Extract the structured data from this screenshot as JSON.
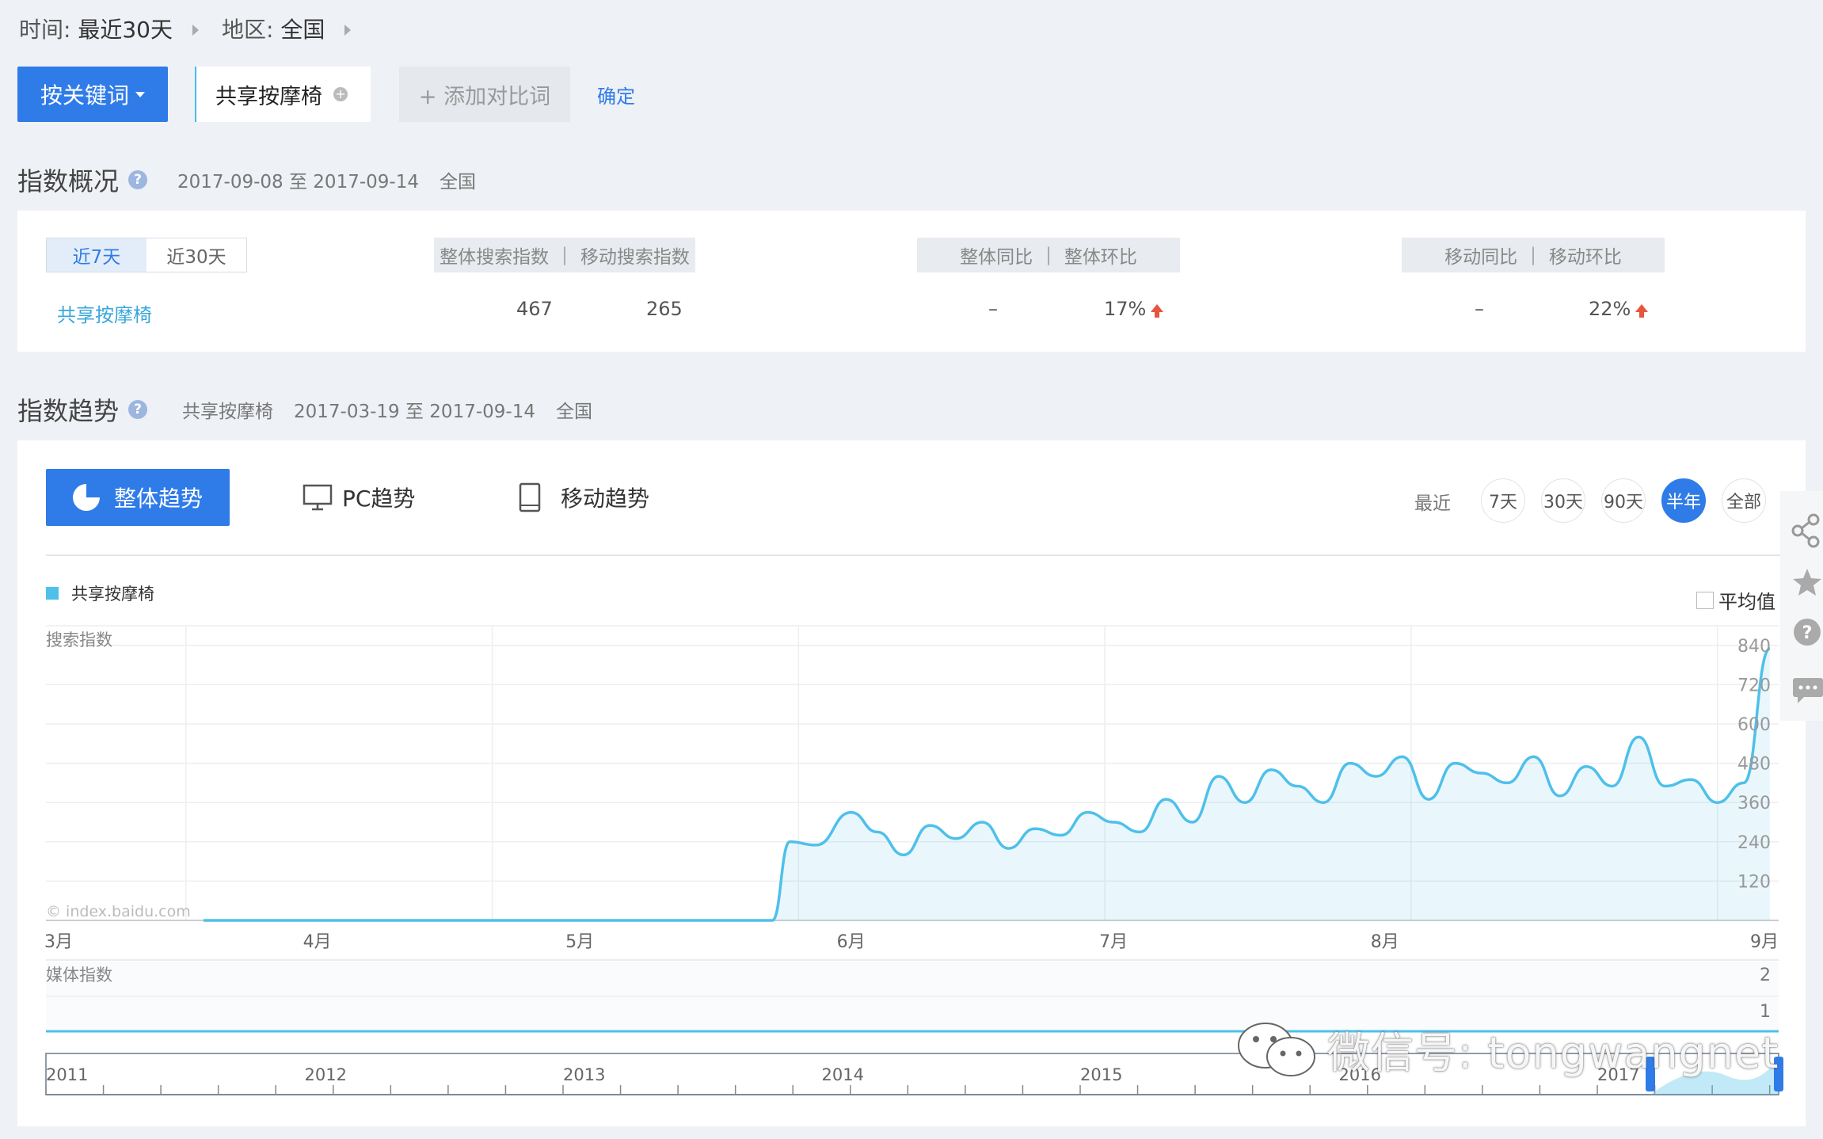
{
  "filters": {
    "time_label": "时间:",
    "time_value": "最近30天",
    "region_label": "地区:",
    "region_value": "全国"
  },
  "toolbar": {
    "mode_button": "按关键词",
    "keyword": "共享按摩椅",
    "add_compare": "+ 添加对比词",
    "confirm": "确定"
  },
  "overview": {
    "title": "指数概况",
    "help": "?",
    "date_range": "2017-09-08 至 2017-09-14",
    "region": "全国",
    "tabs": [
      "近7天",
      "近30天"
    ],
    "col_search": "整体搜索指数",
    "col_mobile": "移动搜索指数",
    "col_yoy": "整体同比",
    "col_mom": "整体环比",
    "col_mobile_yoy": "移动同比",
    "col_mobile_mom": "移动环比",
    "row": {
      "keyword": "共享按摩椅",
      "search_index": "467",
      "mobile_index": "265",
      "yoy": "–",
      "mom": "17%",
      "mobile_yoy": "–",
      "mobile_mom": "22%"
    }
  },
  "trend": {
    "title": "指数趋势",
    "help": "?",
    "keyword": "共享按摩椅",
    "date_range": "2017-03-19 至 2017-09-14",
    "region": "全国",
    "tabs": {
      "overall": "整体趋势",
      "pc": "PC趋势",
      "mobile": "移动趋势"
    },
    "recent_label": "最近",
    "ranges": [
      "7天",
      "30天",
      "90天",
      "半年",
      "全部"
    ],
    "active_range": 3,
    "avg_label": "平均值",
    "copyright": "© index.baidu.com",
    "media_label": "媒体指数",
    "media_ticks": [
      "2",
      "1"
    ],
    "timeline_years": [
      "2011",
      "2012",
      "2013",
      "2014",
      "2015",
      "2016",
      "2017"
    ]
  },
  "colors": {
    "accent": "#2f7ce8",
    "series": "#4ec0ea",
    "up": "#e8553e"
  },
  "icons": [
    "pie-chart-icon",
    "monitor-icon",
    "tablet-icon",
    "share-icon",
    "star-icon",
    "help-icon",
    "chat-icon",
    "wechat-icon"
  ],
  "watermark": "微信号: tongwangnet",
  "chart_data": {
    "type": "area",
    "title": "",
    "ylabel": "搜索指数",
    "ylim": [
      0,
      900
    ],
    "yticks": [
      120,
      240,
      360,
      480,
      600,
      720,
      840
    ],
    "xticks": [
      "3月",
      "4月",
      "5月",
      "6月",
      "7月",
      "8月",
      "9月"
    ],
    "series": [
      {
        "name": "共享按摩椅",
        "x": [
          "2017-03-19",
          "2017-05-23",
          "2017-05-25",
          "2017-05-28",
          "2017-06-01",
          "2017-06-04",
          "2017-06-07",
          "2017-06-10",
          "2017-06-13",
          "2017-06-16",
          "2017-06-19",
          "2017-06-22",
          "2017-06-25",
          "2017-06-28",
          "2017-07-01",
          "2017-07-04",
          "2017-07-07",
          "2017-07-10",
          "2017-07-13",
          "2017-07-16",
          "2017-07-19",
          "2017-07-22",
          "2017-07-25",
          "2017-07-28",
          "2017-07-31",
          "2017-08-03",
          "2017-08-06",
          "2017-08-09",
          "2017-08-12",
          "2017-08-15",
          "2017-08-18",
          "2017-08-21",
          "2017-08-24",
          "2017-08-27",
          "2017-08-30",
          "2017-09-02",
          "2017-09-05",
          "2017-09-08",
          "2017-09-11",
          "2017-09-14"
        ],
        "y": [
          0,
          0,
          240,
          230,
          330,
          270,
          200,
          290,
          250,
          300,
          220,
          280,
          260,
          330,
          300,
          270,
          370,
          300,
          440,
          360,
          460,
          410,
          360,
          480,
          440,
          500,
          370,
          480,
          450,
          420,
          500,
          380,
          470,
          410,
          560,
          410,
          430,
          360,
          420,
          830
        ]
      }
    ],
    "media": {
      "label": "媒体指数",
      "ylim": [
        0,
        2
      ],
      "values": [
        0,
        0
      ]
    }
  }
}
